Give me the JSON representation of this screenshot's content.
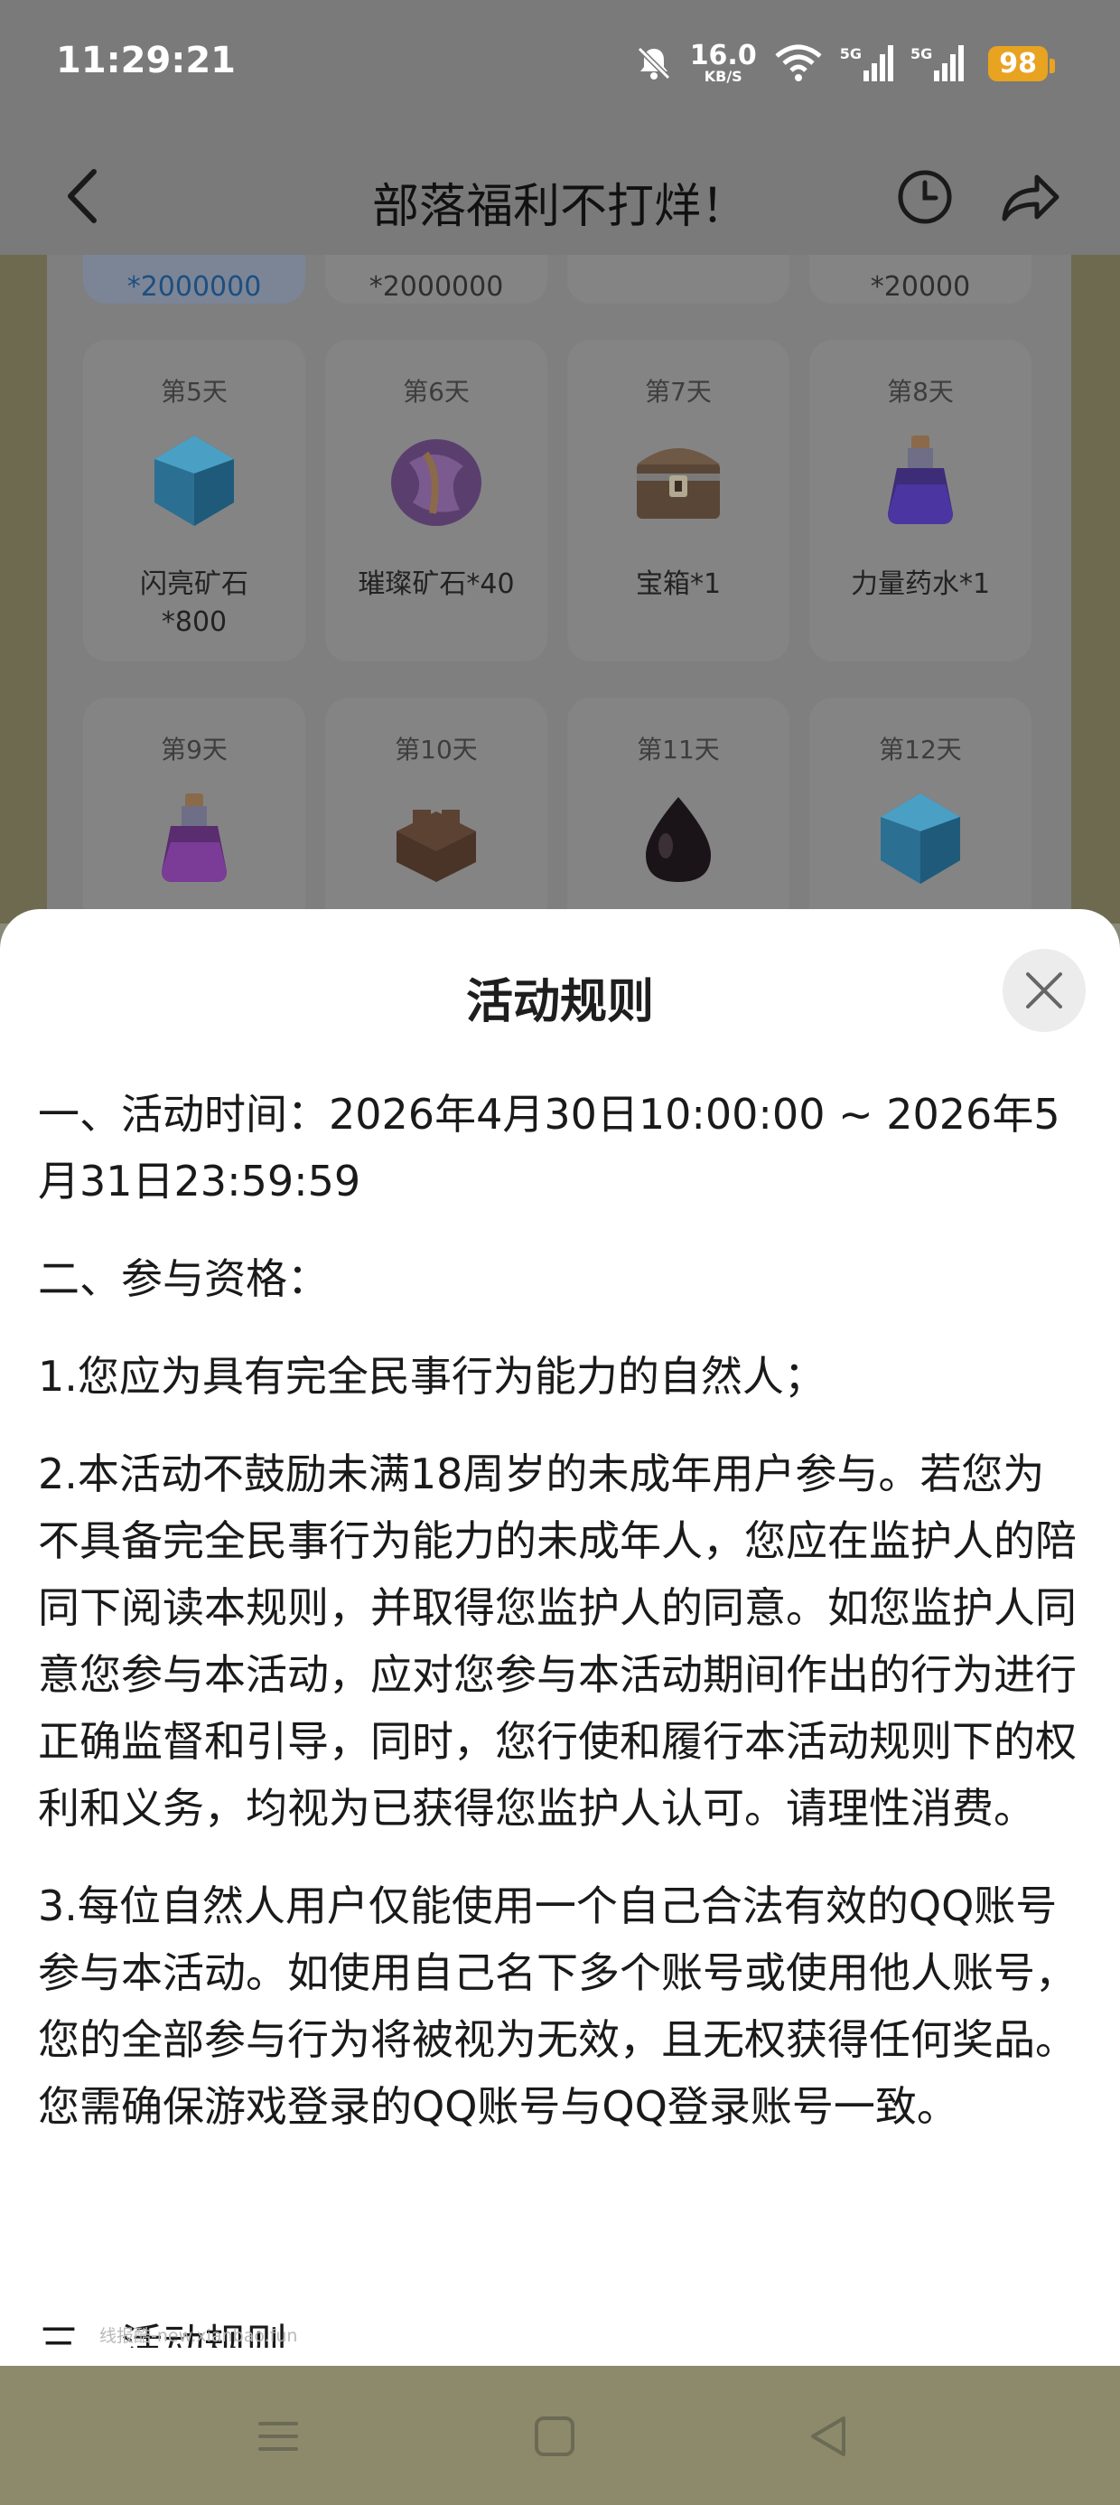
{
  "status_bar": {
    "time": "11:29:21",
    "net_speed_value": "16.0",
    "net_speed_unit": "KB/S",
    "signal_label_1": "5G",
    "signal_label_2": "5G",
    "battery": "98"
  },
  "header": {
    "title": "部落福利不打烊！"
  },
  "rewards": {
    "top_row": [
      "*2000000",
      "*2000000",
      "",
      "*20000"
    ],
    "row1": [
      {
        "day": "第5天",
        "name": "闪亮矿石\n*800"
      },
      {
        "day": "第6天",
        "name": "璀璨矿石*40"
      },
      {
        "day": "第7天",
        "name": "宝箱*1"
      },
      {
        "day": "第8天",
        "name": "力量药水*1"
      }
    ],
    "row2": [
      {
        "day": "第9天"
      },
      {
        "day": "第10天"
      },
      {
        "day": "第11天"
      },
      {
        "day": "第12天"
      }
    ]
  },
  "modal": {
    "title": "活动规则",
    "rules": [
      "一、活动时间：2026年4月30日10:00:00 ~ 2026年5月31日23:59:59",
      "二、参与资格：",
      "1.您应为具有完全民事行为能力的自然人；",
      "2.本活动不鼓励未满18周岁的未成年用户参与。若您为不具备完全民事行为能力的未成年人，您应在监护人的陪同下阅读本规则，并取得您监护人的同意。如您监护人同意您参与本活动，应对您参与本活动期间作出的行为进行正确监督和引导，同时，您行使和履行本活动规则下的权利和义务，均视为已获得您监护人认可。请理性消费。",
      "3.每位自然人用户仅能使用一个自己合法有效的QQ账号参与本活动。如使用自己名下多个账号或使用他人账号，您的全部参与行为将被视为无效，且无权获得任何奖品。您需确保游戏登录的QQ账号与QQ登录账号一致。"
    ],
    "cut_text": "三、活动规则",
    "watermark": "线报酷-new.xianbao.fun"
  },
  "colors": {
    "battery": "#e8a321",
    "overlay": "#7a7a7a",
    "modal_bg": "#ffffff"
  },
  "icons": {
    "back": "chevron-left-icon",
    "history": "clock-icon",
    "share": "share-arrow-icon",
    "close": "close-icon",
    "nav_menu": "menu-icon",
    "nav_home": "square-icon",
    "nav_back": "triangle-back-icon"
  }
}
